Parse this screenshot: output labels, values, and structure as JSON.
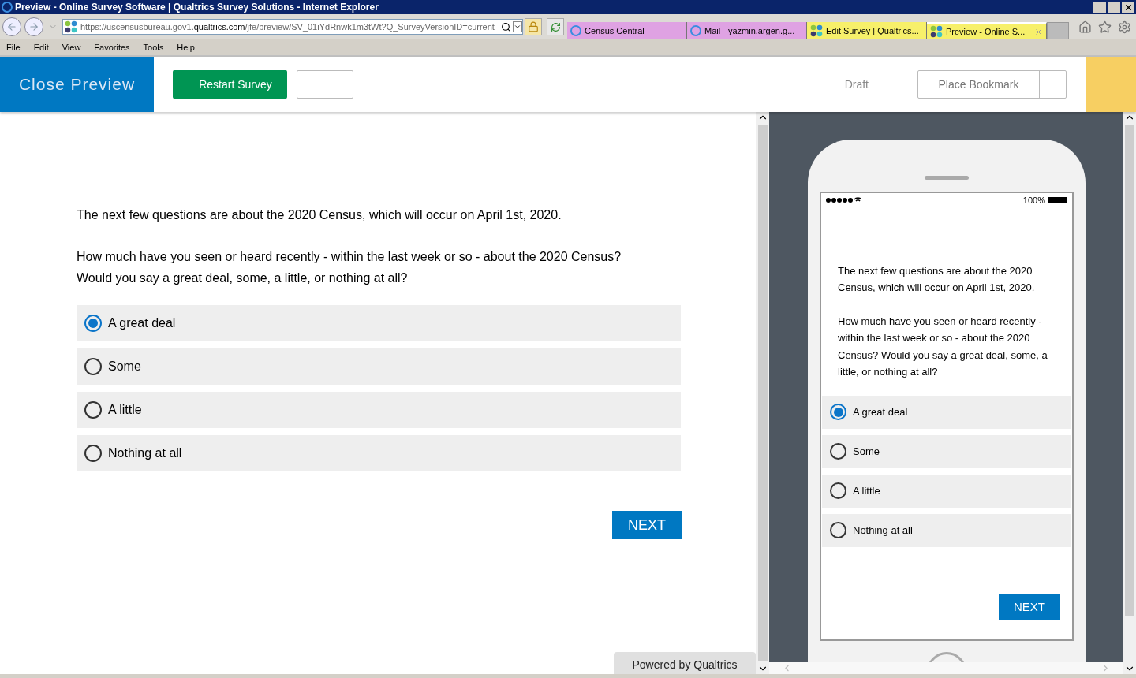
{
  "window": {
    "title": "Preview - Online Survey Software | Qualtrics Survey Solutions - Internet Explorer"
  },
  "browser": {
    "url_parts": [
      {
        "text": "https://uscensusbureau.gov1.",
        "kind": "muted"
      },
      {
        "text": "qualtrics.com",
        "kind": "domain"
      },
      {
        "text": "/jfe/preview/SV_01iYdRnwk1m3tWt?Q_SurveyVersionID=current",
        "kind": "muted"
      }
    ],
    "tabs": [
      {
        "label": "Census Central",
        "kind": "ie",
        "color": "#dfa2e3",
        "selected": false
      },
      {
        "label": "Mail - yazmin.argen.g...",
        "kind": "ie",
        "color": "#dfa2e3",
        "selected": false
      },
      {
        "label": "Edit Survey | Qualtrics...",
        "kind": "qualtrics",
        "color": "#f7f06a",
        "selected": false
      },
      {
        "label": "Preview - Online S...",
        "kind": "qualtrics",
        "color": "#f7f06a",
        "selected": true
      }
    ],
    "menu": [
      "File",
      "Edit",
      "View",
      "Favorites",
      "Tools",
      "Help"
    ]
  },
  "preview_bar": {
    "close": "Close Preview",
    "restart": "Restart Survey",
    "status": "Draft",
    "bookmark": "Place Bookmark"
  },
  "survey": {
    "intro": "The next few questions are about the 2020 Census, which will occur on April 1st, 2020.",
    "question": "How much have you seen or heard recently - within the last week or so - about the 2020 Census? Would you say a great deal, some, a little, or nothing at all?",
    "options": [
      {
        "label": "A great deal",
        "selected": true
      },
      {
        "label": "Some",
        "selected": false
      },
      {
        "label": "A little",
        "selected": false
      },
      {
        "label": "Nothing at all",
        "selected": false
      }
    ],
    "next": "NEXT",
    "footer": "Powered by Qualtrics"
  },
  "mobile_preview": {
    "battery": "100%",
    "intro": "The next few questions are about the 2020 Census, which will occur on April 1st, 2020.",
    "question": "How much have you seen or heard recently - within the last week or so - about the 2020 Census? Would you say a great deal, some, a little, or nothing at all?",
    "options": [
      {
        "label": "A great deal",
        "selected": true
      },
      {
        "label": "Some",
        "selected": false
      },
      {
        "label": "A little",
        "selected": false
      },
      {
        "label": "Nothing at all",
        "selected": false
      }
    ],
    "next": "NEXT"
  }
}
